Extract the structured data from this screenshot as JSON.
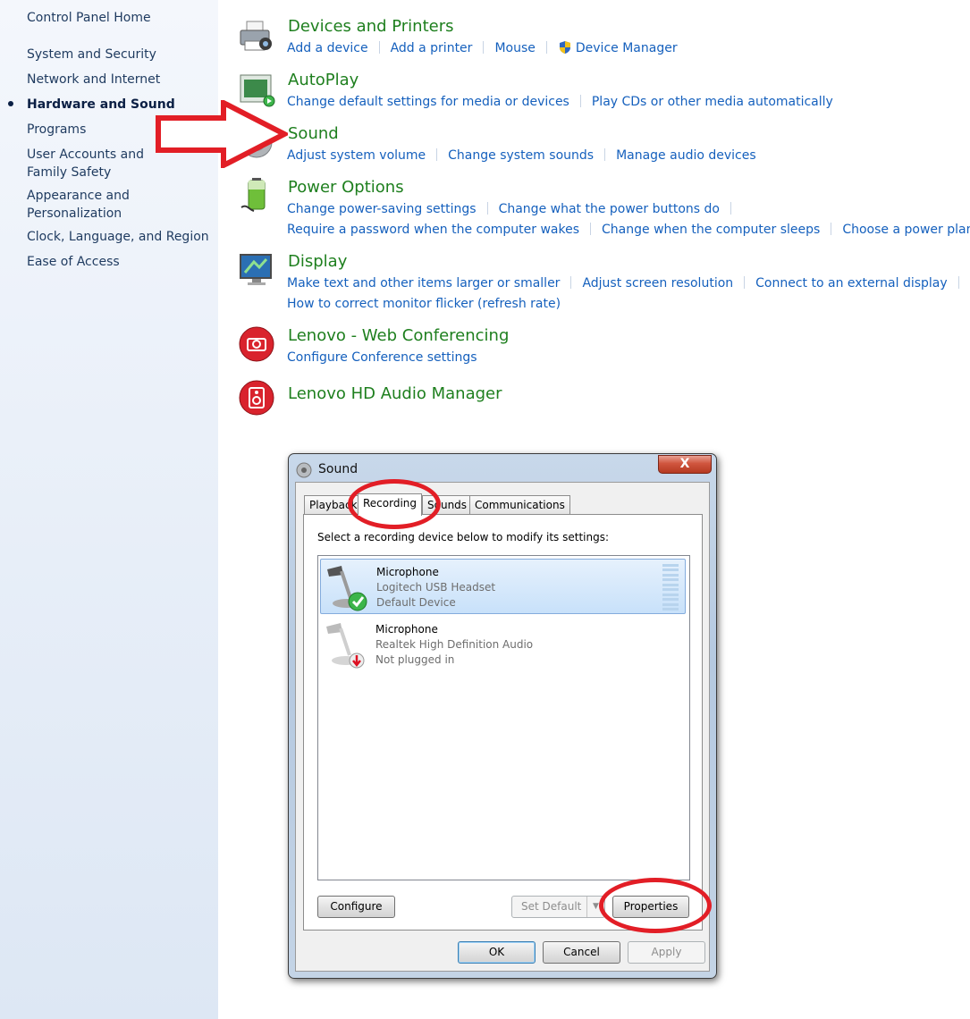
{
  "nav": {
    "items": [
      "Control Panel Home",
      "System and Security",
      "Network and Internet",
      "Hardware and Sound",
      "Programs",
      "User Accounts and Family Safety",
      "Appearance and Personalization",
      "Clock, Language, and Region",
      "Ease of Access"
    ],
    "active_index": 3
  },
  "sections": {
    "devices": {
      "title": "Devices and Printers",
      "links": [
        "Add a device",
        "Add a printer",
        "Mouse",
        "Device Manager"
      ]
    },
    "autoplay": {
      "title": "AutoPlay",
      "links": [
        "Change default settings for media or devices",
        "Play CDs or other media automatically"
      ]
    },
    "sound": {
      "title": "Sound",
      "links": [
        "Adjust system volume",
        "Change system sounds",
        "Manage audio devices"
      ]
    },
    "power": {
      "title": "Power Options",
      "links": [
        "Change power-saving settings",
        "Change what the power buttons do",
        "Require a password when the computer wakes",
        "Change when the computer sleeps",
        "Choose a power plan"
      ]
    },
    "display": {
      "title": "Display",
      "links": [
        "Make text and other items larger or smaller",
        "Adjust screen resolution",
        "Connect to an external display",
        "How to correct monitor flicker (refresh rate)"
      ]
    },
    "lenovo_web": {
      "title": "Lenovo - Web Conferencing",
      "links": [
        "Configure Conference settings"
      ]
    },
    "lenovo_audio": {
      "title": "Lenovo HD Audio Manager"
    }
  },
  "dialog": {
    "title": "Sound",
    "close_glyph": "X",
    "tabs": [
      "Playback",
      "Recording",
      "Sounds",
      "Communications"
    ],
    "selected_tab": "Recording",
    "caption": "Select a recording device below to modify its settings:",
    "devices": [
      {
        "name": "Microphone",
        "line2": "Logitech USB Headset",
        "line3": "Default Device",
        "status": "default"
      },
      {
        "name": "Microphone",
        "line2": "Realtek High Definition Audio",
        "line3": "Not plugged in",
        "status": "unplugged"
      }
    ],
    "buttons": {
      "configure": "Configure",
      "set_default": "Set Default",
      "properties": "Properties",
      "ok": "OK",
      "cancel": "Cancel",
      "apply": "Apply"
    }
  },
  "colors": {
    "section_title": "#1e7f1e",
    "link": "#1560bd",
    "annotation_red": "#e21e26"
  }
}
